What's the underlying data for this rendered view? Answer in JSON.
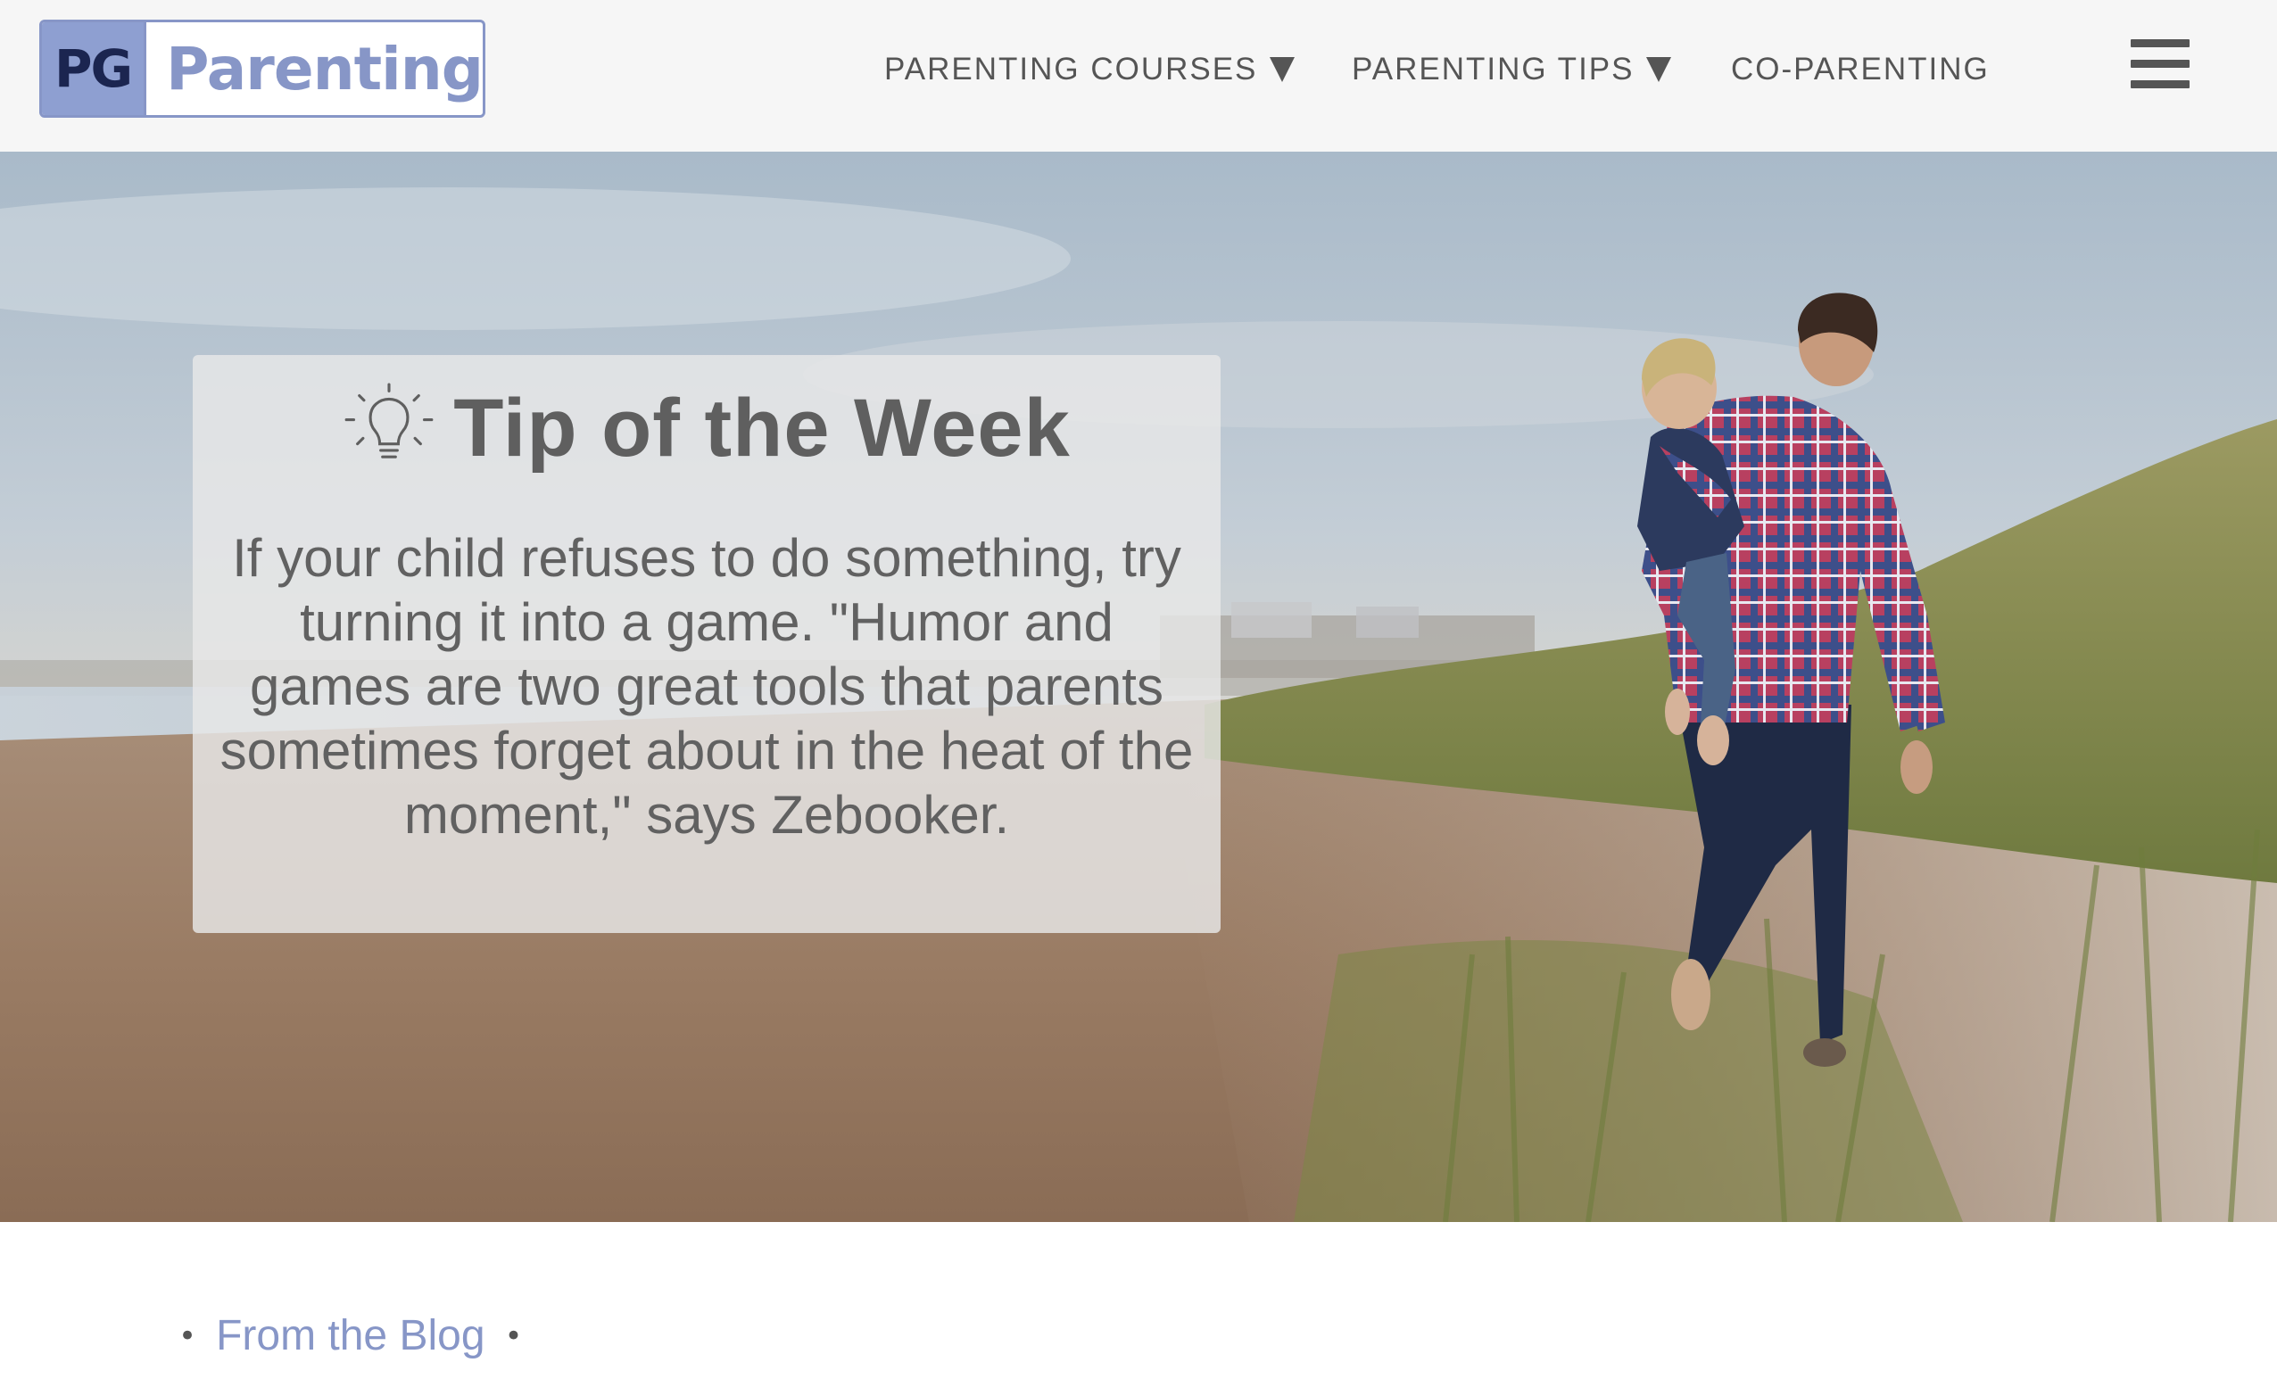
{
  "logo": {
    "mark": "PG",
    "word": "Parenting"
  },
  "nav": {
    "items": [
      {
        "label": "PARENTING COURSES",
        "has_dropdown": true
      },
      {
        "label": "PARENTING TIPS",
        "has_dropdown": true
      },
      {
        "label": "CO-PARENTING",
        "has_dropdown": false
      }
    ],
    "menu_icon": "hamburger-menu-icon"
  },
  "hero": {
    "tip_icon": "lightbulb-icon",
    "tip_title": "Tip of the Week",
    "tip_body": "If your child refuses to do something, try turning it into a game. \"Humor and games are two great tools that parents sometimes forget about in the heat of the moment,\" says Zebooker."
  },
  "blog": {
    "bullet_before": "•",
    "link_label": "From the Blog",
    "bullet_after": "•"
  },
  "colors": {
    "brand": "#8796c7",
    "brand_dark": "#1b2550",
    "header_bg": "#f6f6f6",
    "nav_text": "#555555",
    "tip_text": "#5f5f5f"
  }
}
